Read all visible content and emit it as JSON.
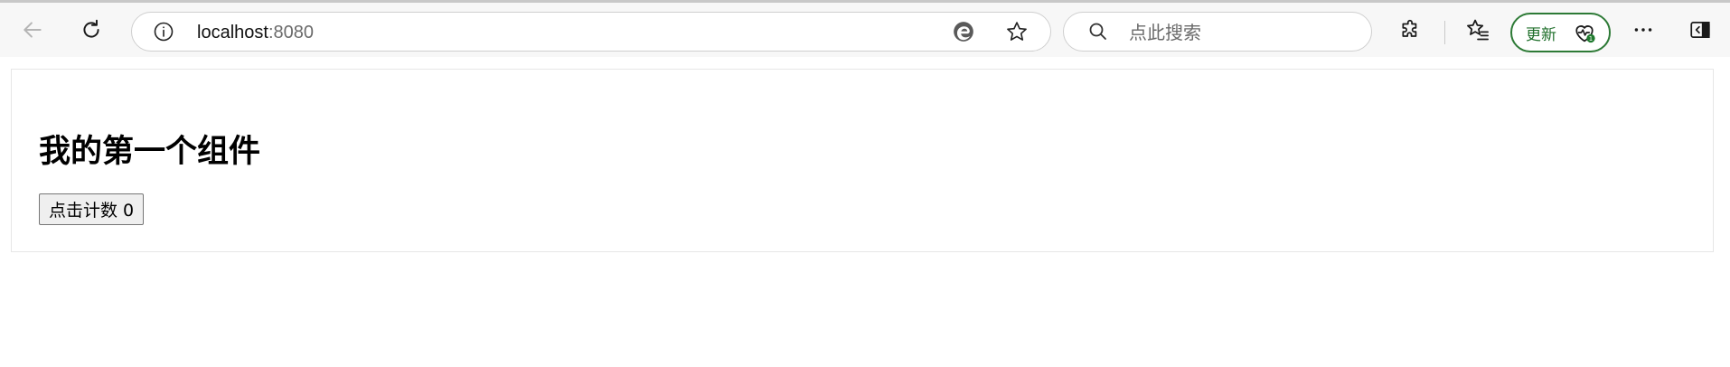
{
  "browser": {
    "url_host": "localhost",
    "url_port": ":8080",
    "search_placeholder": "点此搜索",
    "update_label": "更新",
    "update_badge": "1",
    "icons": {
      "back": "back-arrow-icon",
      "refresh": "refresh-icon",
      "site_info": "info-icon",
      "edge": "edge-logo-icon",
      "favorite": "star-icon",
      "search": "search-icon",
      "extensions": "puzzle-icon",
      "favorites_list": "favorites-icon",
      "health": "heartbeat-icon",
      "more": "more-icon",
      "sidebar": "sidebar-icon"
    }
  },
  "page": {
    "title": "我的第一个组件",
    "button_label": "点击计数 0"
  },
  "colors": {
    "update_green": "#2d7a36",
    "toolbar_bg": "#f7f7f7"
  }
}
